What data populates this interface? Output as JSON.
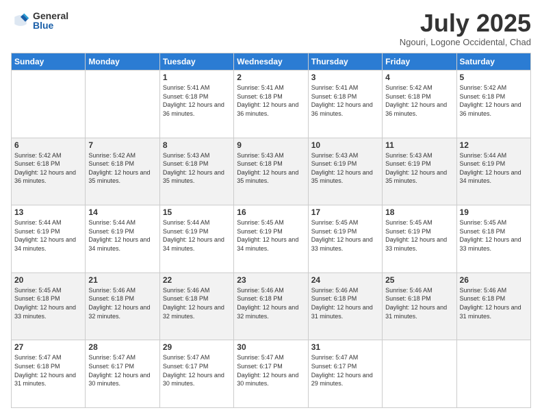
{
  "logo": {
    "general": "General",
    "blue": "Blue"
  },
  "header": {
    "month": "July 2025",
    "location": "Ngouri, Logone Occidental, Chad"
  },
  "days_of_week": [
    "Sunday",
    "Monday",
    "Tuesday",
    "Wednesday",
    "Thursday",
    "Friday",
    "Saturday"
  ],
  "weeks": [
    [
      {
        "day": "",
        "sunrise": "",
        "sunset": "",
        "daylight": ""
      },
      {
        "day": "",
        "sunrise": "",
        "sunset": "",
        "daylight": ""
      },
      {
        "day": "1",
        "sunrise": "Sunrise: 5:41 AM",
        "sunset": "Sunset: 6:18 PM",
        "daylight": "Daylight: 12 hours and 36 minutes."
      },
      {
        "day": "2",
        "sunrise": "Sunrise: 5:41 AM",
        "sunset": "Sunset: 6:18 PM",
        "daylight": "Daylight: 12 hours and 36 minutes."
      },
      {
        "day": "3",
        "sunrise": "Sunrise: 5:41 AM",
        "sunset": "Sunset: 6:18 PM",
        "daylight": "Daylight: 12 hours and 36 minutes."
      },
      {
        "day": "4",
        "sunrise": "Sunrise: 5:42 AM",
        "sunset": "Sunset: 6:18 PM",
        "daylight": "Daylight: 12 hours and 36 minutes."
      },
      {
        "day": "5",
        "sunrise": "Sunrise: 5:42 AM",
        "sunset": "Sunset: 6:18 PM",
        "daylight": "Daylight: 12 hours and 36 minutes."
      }
    ],
    [
      {
        "day": "6",
        "sunrise": "Sunrise: 5:42 AM",
        "sunset": "Sunset: 6:18 PM",
        "daylight": "Daylight: 12 hours and 36 minutes."
      },
      {
        "day": "7",
        "sunrise": "Sunrise: 5:42 AM",
        "sunset": "Sunset: 6:18 PM",
        "daylight": "Daylight: 12 hours and 35 minutes."
      },
      {
        "day": "8",
        "sunrise": "Sunrise: 5:43 AM",
        "sunset": "Sunset: 6:18 PM",
        "daylight": "Daylight: 12 hours and 35 minutes."
      },
      {
        "day": "9",
        "sunrise": "Sunrise: 5:43 AM",
        "sunset": "Sunset: 6:18 PM",
        "daylight": "Daylight: 12 hours and 35 minutes."
      },
      {
        "day": "10",
        "sunrise": "Sunrise: 5:43 AM",
        "sunset": "Sunset: 6:19 PM",
        "daylight": "Daylight: 12 hours and 35 minutes."
      },
      {
        "day": "11",
        "sunrise": "Sunrise: 5:43 AM",
        "sunset": "Sunset: 6:19 PM",
        "daylight": "Daylight: 12 hours and 35 minutes."
      },
      {
        "day": "12",
        "sunrise": "Sunrise: 5:44 AM",
        "sunset": "Sunset: 6:19 PM",
        "daylight": "Daylight: 12 hours and 34 minutes."
      }
    ],
    [
      {
        "day": "13",
        "sunrise": "Sunrise: 5:44 AM",
        "sunset": "Sunset: 6:19 PM",
        "daylight": "Daylight: 12 hours and 34 minutes."
      },
      {
        "day": "14",
        "sunrise": "Sunrise: 5:44 AM",
        "sunset": "Sunset: 6:19 PM",
        "daylight": "Daylight: 12 hours and 34 minutes."
      },
      {
        "day": "15",
        "sunrise": "Sunrise: 5:44 AM",
        "sunset": "Sunset: 6:19 PM",
        "daylight": "Daylight: 12 hours and 34 minutes."
      },
      {
        "day": "16",
        "sunrise": "Sunrise: 5:45 AM",
        "sunset": "Sunset: 6:19 PM",
        "daylight": "Daylight: 12 hours and 34 minutes."
      },
      {
        "day": "17",
        "sunrise": "Sunrise: 5:45 AM",
        "sunset": "Sunset: 6:19 PM",
        "daylight": "Daylight: 12 hours and 33 minutes."
      },
      {
        "day": "18",
        "sunrise": "Sunrise: 5:45 AM",
        "sunset": "Sunset: 6:19 PM",
        "daylight": "Daylight: 12 hours and 33 minutes."
      },
      {
        "day": "19",
        "sunrise": "Sunrise: 5:45 AM",
        "sunset": "Sunset: 6:18 PM",
        "daylight": "Daylight: 12 hours and 33 minutes."
      }
    ],
    [
      {
        "day": "20",
        "sunrise": "Sunrise: 5:45 AM",
        "sunset": "Sunset: 6:18 PM",
        "daylight": "Daylight: 12 hours and 33 minutes."
      },
      {
        "day": "21",
        "sunrise": "Sunrise: 5:46 AM",
        "sunset": "Sunset: 6:18 PM",
        "daylight": "Daylight: 12 hours and 32 minutes."
      },
      {
        "day": "22",
        "sunrise": "Sunrise: 5:46 AM",
        "sunset": "Sunset: 6:18 PM",
        "daylight": "Daylight: 12 hours and 32 minutes."
      },
      {
        "day": "23",
        "sunrise": "Sunrise: 5:46 AM",
        "sunset": "Sunset: 6:18 PM",
        "daylight": "Daylight: 12 hours and 32 minutes."
      },
      {
        "day": "24",
        "sunrise": "Sunrise: 5:46 AM",
        "sunset": "Sunset: 6:18 PM",
        "daylight": "Daylight: 12 hours and 31 minutes."
      },
      {
        "day": "25",
        "sunrise": "Sunrise: 5:46 AM",
        "sunset": "Sunset: 6:18 PM",
        "daylight": "Daylight: 12 hours and 31 minutes."
      },
      {
        "day": "26",
        "sunrise": "Sunrise: 5:46 AM",
        "sunset": "Sunset: 6:18 PM",
        "daylight": "Daylight: 12 hours and 31 minutes."
      }
    ],
    [
      {
        "day": "27",
        "sunrise": "Sunrise: 5:47 AM",
        "sunset": "Sunset: 6:18 PM",
        "daylight": "Daylight: 12 hours and 31 minutes."
      },
      {
        "day": "28",
        "sunrise": "Sunrise: 5:47 AM",
        "sunset": "Sunset: 6:17 PM",
        "daylight": "Daylight: 12 hours and 30 minutes."
      },
      {
        "day": "29",
        "sunrise": "Sunrise: 5:47 AM",
        "sunset": "Sunset: 6:17 PM",
        "daylight": "Daylight: 12 hours and 30 minutes."
      },
      {
        "day": "30",
        "sunrise": "Sunrise: 5:47 AM",
        "sunset": "Sunset: 6:17 PM",
        "daylight": "Daylight: 12 hours and 30 minutes."
      },
      {
        "day": "31",
        "sunrise": "Sunrise: 5:47 AM",
        "sunset": "Sunset: 6:17 PM",
        "daylight": "Daylight: 12 hours and 29 minutes."
      },
      {
        "day": "",
        "sunrise": "",
        "sunset": "",
        "daylight": ""
      },
      {
        "day": "",
        "sunrise": "",
        "sunset": "",
        "daylight": ""
      }
    ]
  ]
}
